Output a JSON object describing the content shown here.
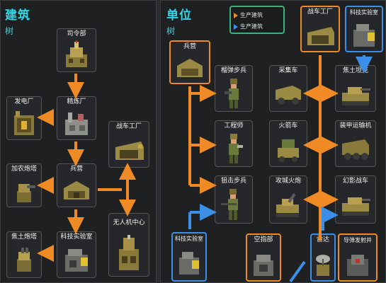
{
  "left": {
    "title": "建筑",
    "subtitle": "树",
    "nodes": {
      "hq": "司令部",
      "refinery": "精炼厂",
      "power": "发电厂",
      "barracks": "兵营",
      "cannon": "加农炮塔",
      "tank_factory": "战车工厂",
      "drone": "无人机中心",
      "turret": "焦土炮塔",
      "lab": "科技实验室"
    }
  },
  "right": {
    "title": "单位",
    "subtitle": "树",
    "legend": {
      "production": "生产建筑",
      "tech": "生产建筑",
      "production_color": "#f08a24",
      "tech_color": "#3b8fe6"
    },
    "nodes": {
      "barracks": "兵营",
      "tank_factory": "战车工厂",
      "lab_top": "科技实验室",
      "grenadier": "榴弹步兵",
      "harvester": "采集车",
      "scorch_tank": "焦土坦克",
      "engineer": "工程师",
      "rocket_car": "火箭车",
      "apc": "装甲运输机",
      "sniper": "狙击步兵",
      "siege_cannon": "攻城火炮",
      "phantom": "幻影战车",
      "lab_bottom": "科技实验室",
      "airport": "空指部",
      "radar": "雷达",
      "missile": "导弹发射井"
    }
  }
}
